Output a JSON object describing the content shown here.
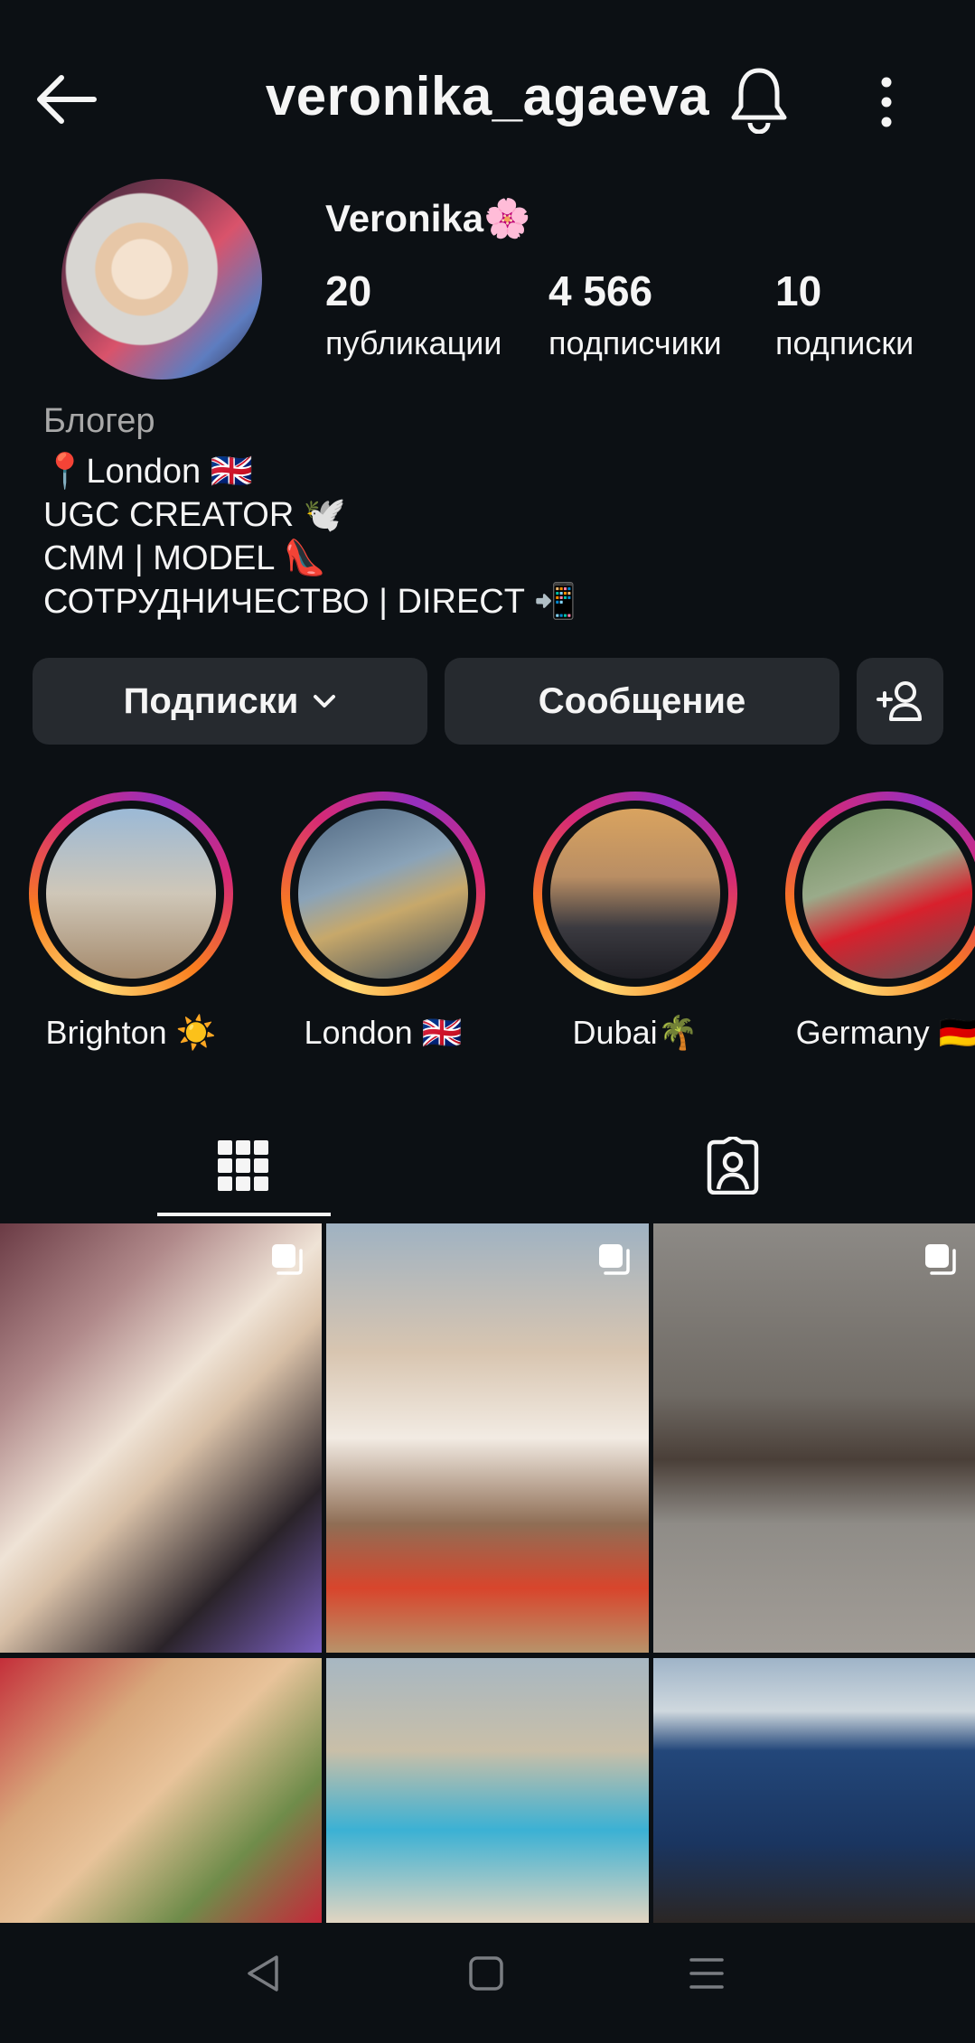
{
  "header": {
    "username": "veronika_agaeva",
    "back_icon": "arrow-left-icon",
    "bell_icon": "bell-icon",
    "more_icon": "more-vertical-icon"
  },
  "profile": {
    "display_name": "Veronika🌸",
    "stats": [
      {
        "value": "20",
        "label": "публикации"
      },
      {
        "value": "4 566",
        "label": "подписчики"
      },
      {
        "value": "10",
        "label": "подписки"
      }
    ],
    "category": "Блогер",
    "bio": [
      "📍London 🇬🇧",
      "UGC CREATOR 🕊️",
      "СММ | MODEL 👠",
      "СОТРУДНИЧЕСТВО | DIRECT 📲"
    ]
  },
  "actions": {
    "following_label": "Подписки",
    "message_label": "Сообщение",
    "add_user_icon": "person-add-icon"
  },
  "highlights": [
    {
      "label": "Brighton ☀️"
    },
    {
      "label": "London 🇬🇧"
    },
    {
      "label": "Dubai🌴"
    },
    {
      "label": "Germany 🇩🇪"
    }
  ],
  "tabs": [
    {
      "name": "posts-grid",
      "icon": "grid-icon",
      "active": true
    },
    {
      "name": "tagged",
      "icon": "tagged-person-icon",
      "active": false
    }
  ],
  "nav": {
    "back": "triangle-back-icon",
    "home": "square-home-icon",
    "menu": "menu-lines-icon"
  },
  "colors": {
    "background": "#0c1014",
    "button": "#262a2f",
    "secondary_text": "#a8a8a8"
  }
}
